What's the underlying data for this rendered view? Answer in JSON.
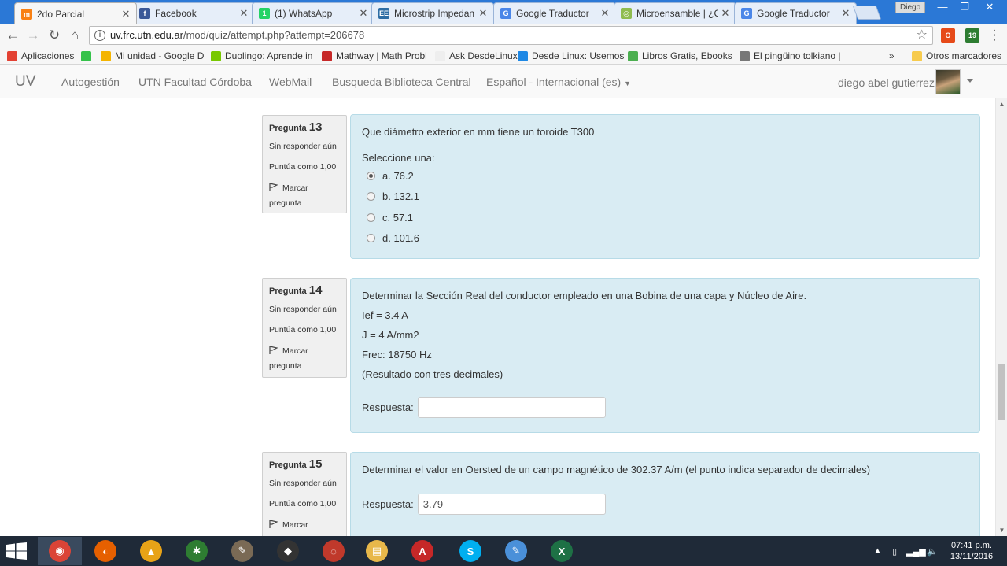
{
  "tabs": [
    {
      "title": "2do Parcial",
      "icon": "moodle-icon",
      "color": "#f98012",
      "glyph": "m",
      "active": true
    },
    {
      "title": "Facebook",
      "icon": "facebook-icon",
      "color": "#3b5998",
      "glyph": "f",
      "active": false
    },
    {
      "title": "(1) WhatsApp",
      "icon": "whatsapp-icon",
      "color": "#25d366",
      "glyph": "1",
      "active": false
    },
    {
      "title": "Microstrip Impedan",
      "icon": "ee-icon",
      "color": "#2e6da4",
      "glyph": "EE",
      "active": false
    },
    {
      "title": "Google Traductor",
      "icon": "translate-icon",
      "color": "#4a86e8",
      "glyph": "G",
      "active": false
    },
    {
      "title": "Microensamble | ¿C",
      "icon": "microensamble-icon",
      "color": "#8fbc4f",
      "glyph": "◎",
      "active": false
    },
    {
      "title": "Google Traductor",
      "icon": "translate-icon",
      "color": "#4a86e8",
      "glyph": "G",
      "active": false
    }
  ],
  "window": {
    "profile_name": "Diego"
  },
  "address": {
    "host": "uv.frc.utn.edu.ar",
    "path": "/mod/quiz/attempt.php?attempt=206678"
  },
  "extensions": {
    "badge": "19"
  },
  "bookmarks": [
    {
      "label": "Aplicaciones",
      "color": "#e34133"
    },
    {
      "label": "",
      "color": "#35c24a"
    },
    {
      "label": "Mi unidad - Google D",
      "color": "#f4b400"
    },
    {
      "label": "Duolingo: Aprende in",
      "color": "#78c800"
    },
    {
      "label": "Mathway | Math Probl",
      "color": "#c62828"
    },
    {
      "label": "Ask DesdeLinux",
      "color": "#eeeeee"
    },
    {
      "label": "Desde Linux: Usemos",
      "color": "#1e88e5"
    },
    {
      "label": "Libros Gratis, Ebooks",
      "color": "#4caf50"
    },
    {
      "label": "El pingüino tolkiano |",
      "color": "#777777"
    }
  ],
  "bookmarks_more": "»",
  "bookmarks_other": "Otros marcadores",
  "site": {
    "brand": "UV",
    "links": [
      "Autogestión",
      "UTN Facultad Córdoba",
      "WebMail",
      "Busqueda Biblioteca Central",
      "Español - Internacional (es)"
    ],
    "user": "diego abel gutierrez"
  },
  "questions": [
    {
      "label": "Pregunta",
      "number": "13",
      "state": "Sin responder aún",
      "grade": "Puntúa como 1,00",
      "flag": "Marcar pregunta",
      "text": [
        "Que diámetro exterior en mm tiene un toroide T300"
      ],
      "prompt": "Seleccione una:",
      "options": [
        "a. 76.2",
        "b. 132.1",
        "c. 57.1",
        "d. 101.6"
      ],
      "selected": 0
    },
    {
      "label": "Pregunta",
      "number": "14",
      "state": "Sin responder aún",
      "grade": "Puntúa como 1,00",
      "flag": "Marcar pregunta",
      "text": [
        "Determinar la Sección Real del conductor empleado en una Bobina de una capa y Núcleo de Aire.",
        "Ief = 3.4 A",
        "J = 4 A/mm2",
        "Frec: 18750 Hz",
        "(Resultado con tres decimales)"
      ],
      "answer_label": "Respuesta:",
      "answer_value": ""
    },
    {
      "label": "Pregunta",
      "number": "15",
      "state": "Sin responder aún",
      "grade": "Puntúa como 1,00",
      "flag": "Marcar",
      "text": [
        "Determinar el valor en Oersted de un campo magnético de 302.37 A/m (el punto indica separador de decimales)"
      ],
      "answer_label": "Respuesta:",
      "answer_value": "3.79"
    }
  ],
  "taskbar": {
    "apps": [
      {
        "name": "chrome",
        "color": "#db4437",
        "glyph": "◉"
      },
      {
        "name": "firefox",
        "color": "#e66000",
        "glyph": "◐"
      },
      {
        "name": "autocad",
        "color": "#e8a317",
        "glyph": "▲"
      },
      {
        "name": "app-shield",
        "color": "#2e7d32",
        "glyph": "✱"
      },
      {
        "name": "gimp",
        "color": "#7a6a55",
        "glyph": "✎"
      },
      {
        "name": "inkscape",
        "color": "#333333",
        "glyph": "◆"
      },
      {
        "name": "app-swirl",
        "color": "#c0392b",
        "glyph": "◌"
      },
      {
        "name": "file-explorer",
        "color": "#e8b84a",
        "glyph": "▤"
      },
      {
        "name": "acrobat",
        "color": "#c62828",
        "glyph": "A"
      },
      {
        "name": "skype",
        "color": "#00aff0",
        "glyph": "S"
      },
      {
        "name": "paint",
        "color": "#4a90d9",
        "glyph": "✎"
      },
      {
        "name": "excel",
        "color": "#1e7145",
        "glyph": "X"
      }
    ],
    "time": "07:41 p.m.",
    "date": "13/11/2016"
  }
}
